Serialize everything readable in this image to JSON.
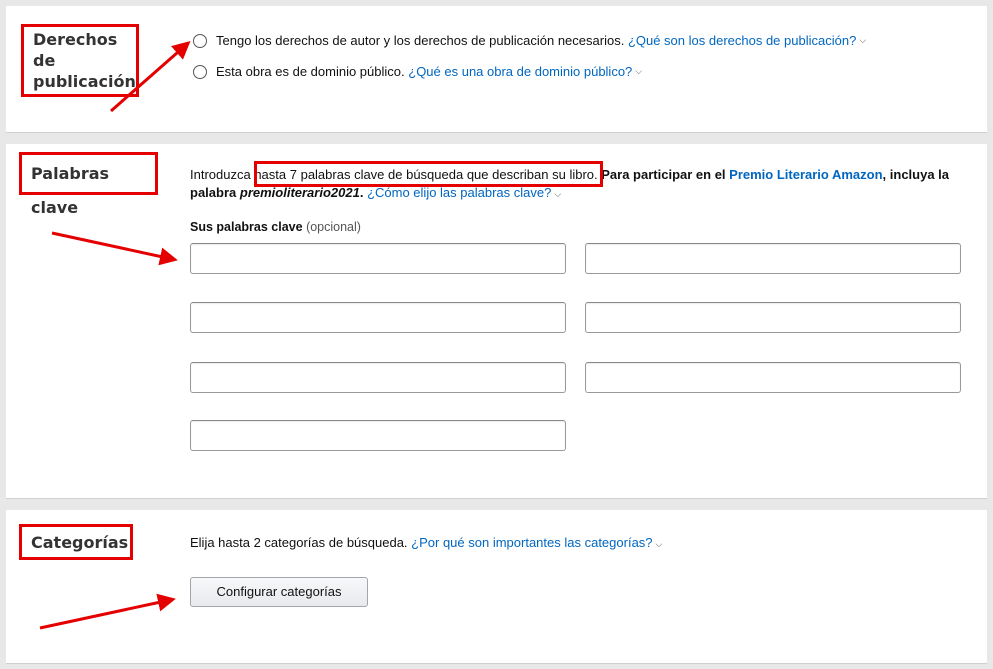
{
  "rights": {
    "label": "Derechos de publicación",
    "option1_text": "Tengo los derechos de autor y los derechos de publicación necesarios.",
    "option1_link": "¿Qué son los derechos de publicación?",
    "option2_text": "Esta obra es de dominio público.",
    "option2_link": "¿Qué es una obra de dominio público?"
  },
  "keywords": {
    "label": "Palabras clave",
    "desc_intro": "Introduzca",
    "desc_highlight": "hasta 7 palabras clave de búsqueda que describan su libro.",
    "desc_bold1": "Para participar en el",
    "desc_link_award": "Premio Literario Amazon",
    "desc_bold2": ", incluya la palabra",
    "desc_keyword": "premioliterario2021",
    "desc_bold3": ".",
    "desc_help_link": "¿Cómo elijo las palabras clave?",
    "field_label": "Sus palabras clave",
    "field_optional": "(opcional)",
    "inputs": [
      "",
      "",
      "",
      "",
      "",
      "",
      ""
    ]
  },
  "categories": {
    "label": "Categorías",
    "text": "Elija hasta 2 categorías de búsqueda.",
    "link": "¿Por qué son importantes las categorías?",
    "button": "Configurar categorías"
  },
  "colors": {
    "annotation_red": "#e50000",
    "link_blue": "#0066c0",
    "page_background": "#e8e8e8"
  },
  "icons": [
    "chevron-down-icon",
    "arrow-annotation-icon"
  ]
}
